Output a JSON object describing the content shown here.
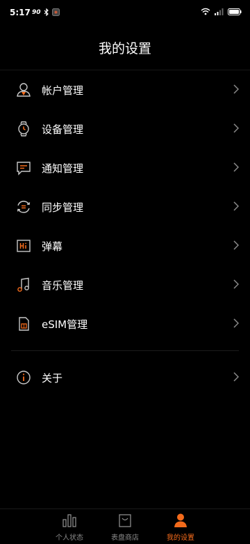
{
  "status_bar": {
    "time": "5:17",
    "data_speed": "90",
    "icons": [
      "vibrate-icon",
      "bluetooth-icon",
      "app-notification-icon",
      "wifi-icon",
      "signal-icon",
      "battery-icon"
    ]
  },
  "header": {
    "title": "我的设置"
  },
  "menu": {
    "items": [
      {
        "label": "帐户管理",
        "icon": "account-icon"
      },
      {
        "label": "设备管理",
        "icon": "watch-icon"
      },
      {
        "label": "通知管理",
        "icon": "notification-message-icon"
      },
      {
        "label": "同步管理",
        "icon": "sync-icon"
      },
      {
        "label": "弹幕",
        "icon": "hi-barrage-icon"
      },
      {
        "label": "音乐管理",
        "icon": "music-icon"
      },
      {
        "label": "eSIM管理",
        "icon": "sim-card-icon"
      }
    ],
    "about": {
      "label": "关于",
      "icon": "info-icon"
    }
  },
  "tabbar": {
    "tabs": [
      {
        "label": "个人状态",
        "icon": "bar-chart-icon",
        "active": false
      },
      {
        "label": "表盘商店",
        "icon": "shopping-bag-icon",
        "active": false
      },
      {
        "label": "我的设置",
        "icon": "user-icon",
        "active": true
      }
    ]
  },
  "colors": {
    "accent": "#f26a1b",
    "icon_gray": "#c8c8c8",
    "background": "#000000"
  }
}
